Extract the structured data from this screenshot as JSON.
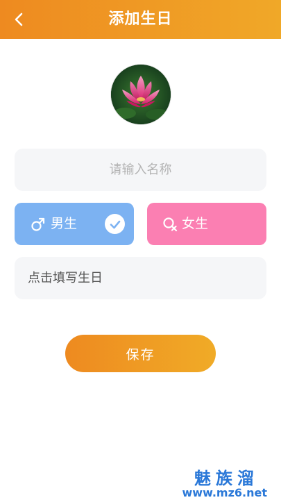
{
  "header": {
    "title": "添加生日",
    "back_icon": "chevron-left-icon",
    "gradient": [
      "#ee8a20",
      "#f0a828"
    ]
  },
  "avatar": {
    "subject": "pink lotus flower photo"
  },
  "name_field": {
    "placeholder": "请输入名称",
    "value": ""
  },
  "gender": {
    "male": {
      "symbol": "♂",
      "label": "男生",
      "selected": true,
      "color": "#7cb2f2"
    },
    "female": {
      "symbol": "♀",
      "label": "女生",
      "selected": false,
      "color": "#fb7fb2"
    }
  },
  "birthday": {
    "label": "点击填写生日"
  },
  "save_button": {
    "label": "保存"
  },
  "watermark": {
    "top": "魅族溜",
    "bottom": "www.mz6.net",
    "color": "#2a78d8"
  }
}
